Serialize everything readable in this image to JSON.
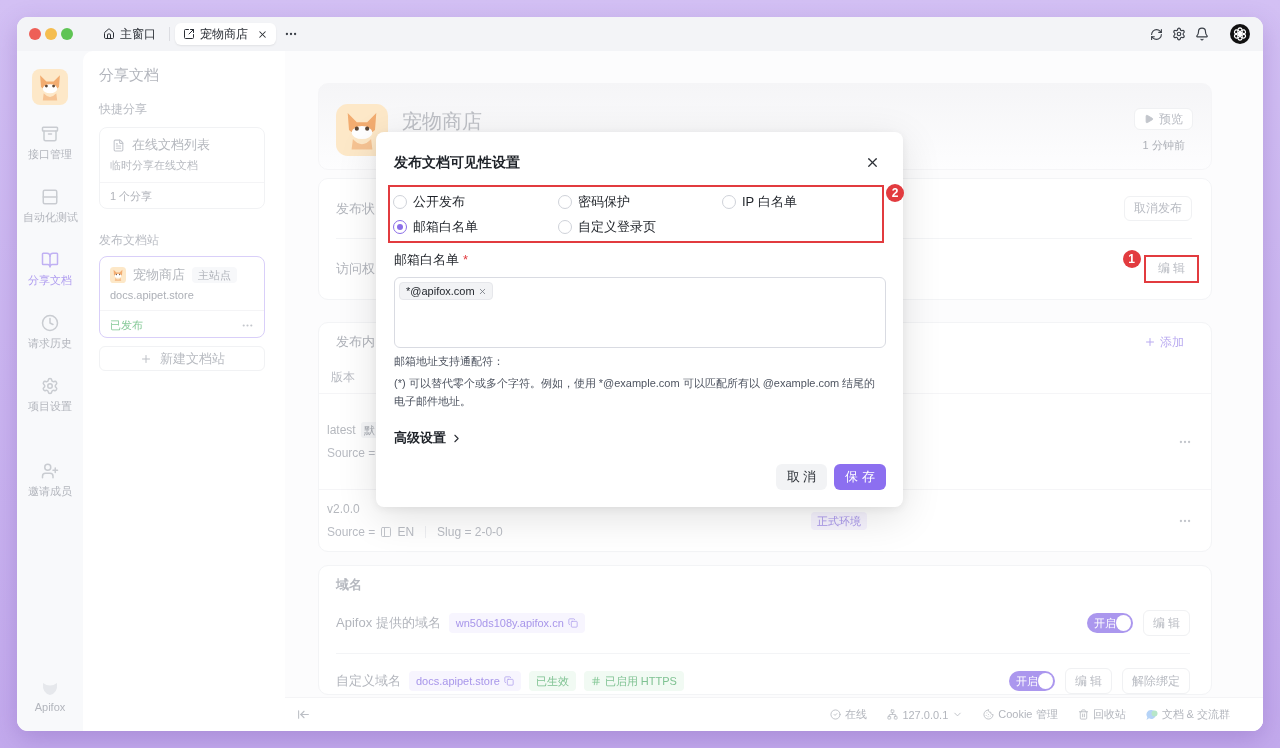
{
  "window": {
    "tabs": [
      {
        "label": "主窗口",
        "selected": false
      },
      {
        "label": "宠物商店",
        "selected": true
      }
    ]
  },
  "nav": {
    "items": [
      {
        "label": "接口管理",
        "selected": false
      },
      {
        "label": "自动化测试",
        "selected": false
      },
      {
        "label": "分享文档",
        "selected": true
      },
      {
        "label": "请求历史",
        "selected": false
      },
      {
        "label": "项目设置",
        "selected": false
      },
      {
        "label": "邀请成员",
        "selected": false
      }
    ],
    "brand": "Apifox"
  },
  "panel": {
    "title": "分享文档",
    "quick_share": {
      "heading": "快捷分享",
      "title": "在线文档列表",
      "subtitle": "临时分享在线文档",
      "count": "1 个分享"
    },
    "sites": {
      "heading": "发布文档站",
      "items": [
        {
          "name": "宠物商店",
          "tag": "主站点",
          "domain": "docs.apipet.store",
          "status": "已发布",
          "selected": true
        }
      ],
      "new_button": "新建文档站"
    }
  },
  "main": {
    "header": {
      "title": "宠物商店",
      "preview_button": "预览",
      "updated": "1 分钟前"
    },
    "publish": {
      "status_label": "发布状",
      "unpublish_button": "取消发布",
      "access_label": "访问权",
      "edit_button": "编 辑",
      "annotation": "1"
    },
    "content": {
      "title": "发布内",
      "add_button": "添加",
      "column_1": "版本",
      "rows": [
        {
          "version": "latest",
          "tag": "默",
          "source": "Source ="
        },
        {
          "version": "v2.0.0",
          "source": "Source =",
          "language": "EN",
          "slug": "Slug = 2-0-0",
          "environment": "正式环境"
        }
      ]
    },
    "domains": {
      "title": "域名",
      "items": [
        {
          "label": "Apifox 提供的域名",
          "domain": "wn50ds108y.apifox.cn",
          "switch": {
            "label": "开启",
            "on": true
          },
          "buttons": [
            "编 辑"
          ]
        },
        {
          "label": "自定义域名",
          "domain": "docs.apipet.store",
          "badges": [
            {
              "text": "已生效",
              "kind": "status"
            },
            {
              "text": "已启用 HTTPS",
              "kind": "https"
            }
          ],
          "switch": {
            "label": "开启",
            "on": true
          },
          "buttons": [
            "编 辑",
            "解除绑定"
          ]
        }
      ]
    }
  },
  "status_bar": {
    "items": [
      {
        "label": "在线",
        "dropdown": false
      },
      {
        "label": "127.0.0.1",
        "dropdown": true
      },
      {
        "label": "Cookie 管理",
        "dropdown": false
      },
      {
        "label": "回收站",
        "dropdown": false
      },
      {
        "label": "文档 & 交流群",
        "dropdown": false
      }
    ]
  },
  "modal": {
    "title": "发布文档可见性设置",
    "options_annotation": "2",
    "options": [
      {
        "label": "公开发布",
        "selected": false
      },
      {
        "label": "密码保护",
        "selected": false
      },
      {
        "label": "IP 白名单",
        "selected": false
      },
      {
        "label": "邮箱白名单",
        "selected": true
      },
      {
        "label": "自定义登录页",
        "selected": false
      }
    ],
    "field": {
      "label": "邮箱白名单",
      "required_mark": "*",
      "tags": [
        "*@apifox.com"
      ]
    },
    "help_title": "邮箱地址支持通配符：",
    "help_text": "(*) 可以替代零个或多个字符。例如，使用 *@example.com 可以匹配所有以 @example.com 结尾的电子邮件地址。",
    "advanced": "高级设置",
    "buttons": [
      {
        "label": "取 消",
        "kind": "secondary"
      },
      {
        "label": "保 存",
        "kind": "primary"
      }
    ]
  }
}
